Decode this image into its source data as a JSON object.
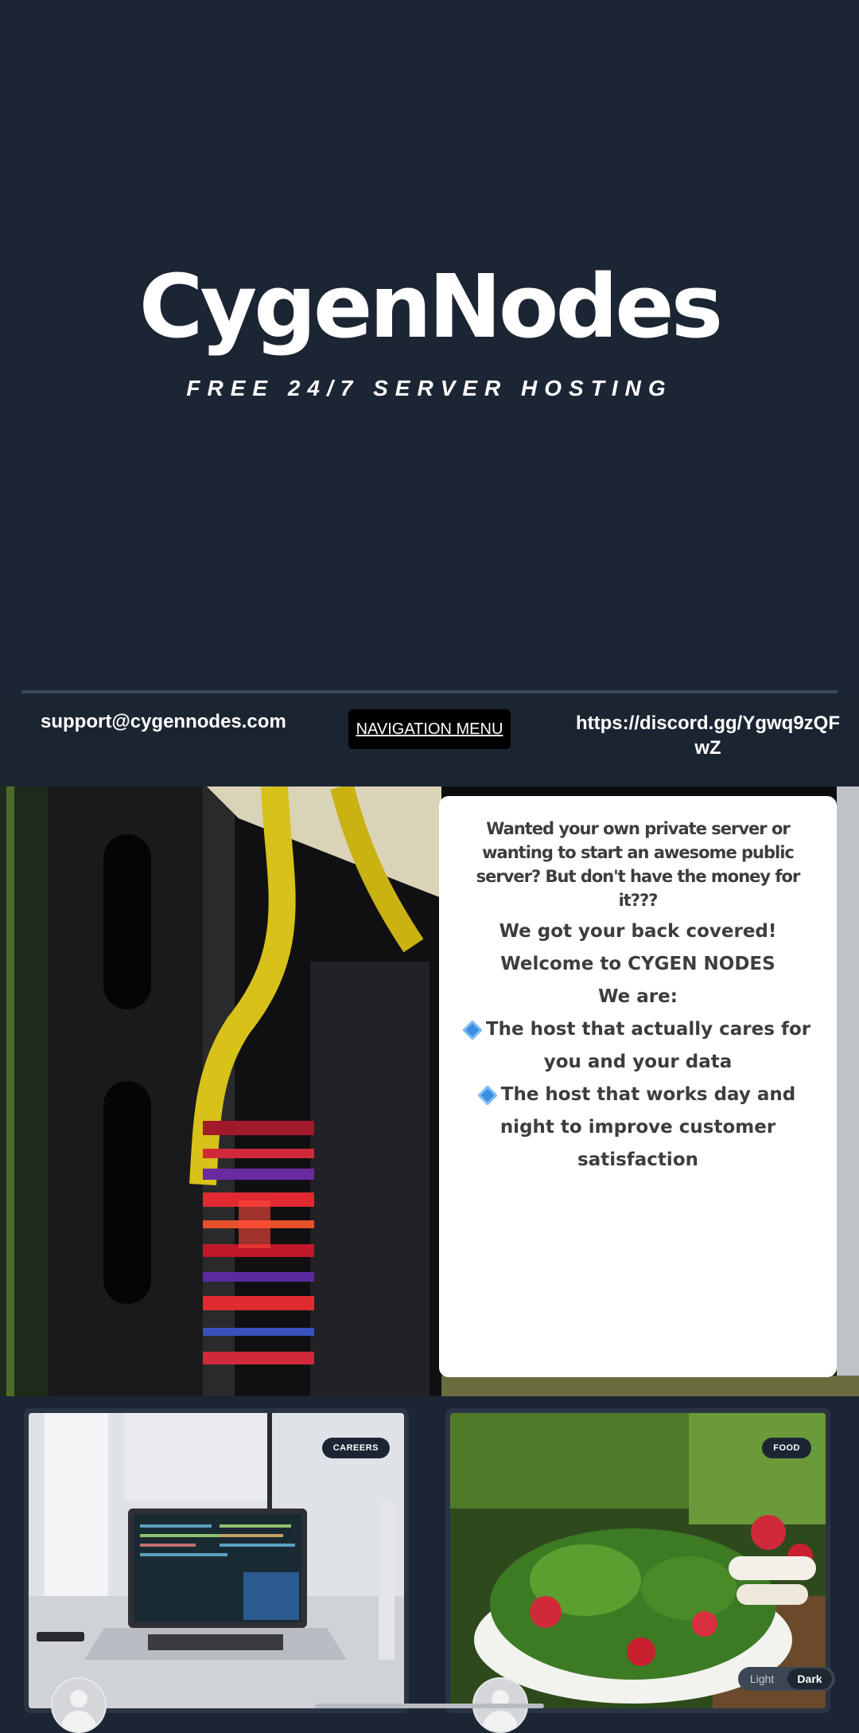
{
  "hero": {
    "brand": "CygenNodes",
    "tagline": "FREE 24/7 SERVER HOSTING"
  },
  "contact": {
    "email": "support@cygennodes.com",
    "nav_button": "NAVIGATION MENU",
    "discord": "https://discord.gg/Ygwq9zQFwZ"
  },
  "info_card": {
    "intro": "Wanted your own private server or wanting to start an awesome public server? But don't have the money for it???",
    "line1": "We got your back covered!",
    "line2": "Welcome to CYGEN NODES",
    "line3": "We are:",
    "bullet1": "The host that actually cares for you and your data",
    "bullet2": "The host that works day and night to improve customer satisfaction"
  },
  "cards": [
    {
      "badge": "CAREERS"
    },
    {
      "badge": "FOOD"
    }
  ],
  "theme_toggle": {
    "light": "Light",
    "dark": "Dark"
  },
  "colors": {
    "background": "#1c2533",
    "card_text": "#3d3d3d",
    "bullet": "#3b8fe3"
  }
}
